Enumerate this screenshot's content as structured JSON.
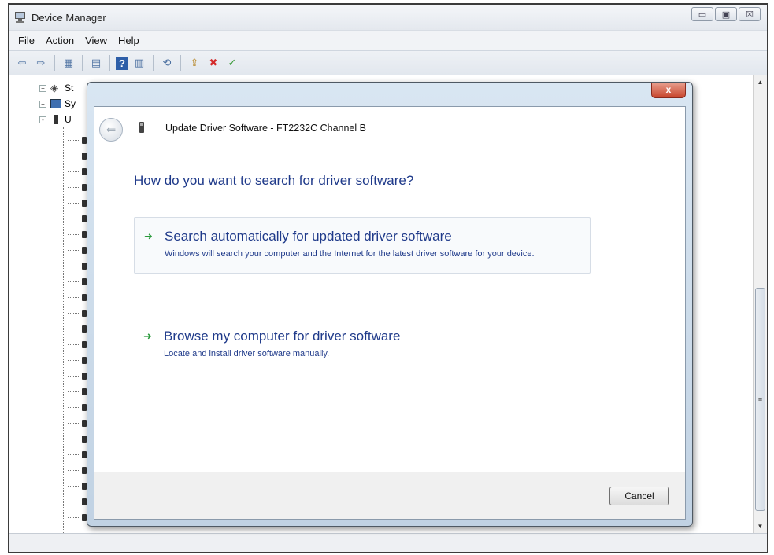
{
  "window": {
    "title": "Device Manager",
    "controls": {
      "minimize": "▭",
      "restore": "▣",
      "close": "☒"
    }
  },
  "menubar": {
    "items": [
      "File",
      "Action",
      "View",
      "Help"
    ]
  },
  "toolbar": {
    "buttons": [
      {
        "icon": "back-arrow-icon",
        "glyph": "⇦"
      },
      {
        "icon": "forward-arrow-icon",
        "glyph": "⇨"
      },
      {
        "icon": "show-hide-tree-icon",
        "glyph": "▦"
      },
      {
        "icon": "properties-icon",
        "glyph": "▤"
      },
      {
        "icon": "help-icon",
        "glyph": "?"
      },
      {
        "icon": "view-icon",
        "glyph": "▥"
      },
      {
        "icon": "scan-hardware-icon",
        "glyph": "⟲"
      },
      {
        "icon": "update-driver-icon",
        "glyph": "⇪"
      },
      {
        "icon": "uninstall-icon",
        "glyph": "✖"
      },
      {
        "icon": "enable-icon",
        "glyph": "✓"
      }
    ]
  },
  "tree": {
    "rows": [
      {
        "expander": "+",
        "label": "St"
      },
      {
        "expander": "+",
        "label": "Sy"
      },
      {
        "expander": "-",
        "label": "U"
      }
    ]
  },
  "dialog": {
    "close_label": "x",
    "title": "Update Driver Software - FT2232C Channel B",
    "question": "How do you want to search for driver software?",
    "options": [
      {
        "title": "Search automatically for updated driver software",
        "description": "Windows will search your computer and the Internet for the latest driver software for your device."
      },
      {
        "title": "Browse my computer for driver software",
        "description": "Locate and install driver software manually."
      }
    ],
    "cancel_label": "Cancel"
  },
  "colors": {
    "link_blue": "#1f3a8a",
    "arrow_green": "#2a9a3c",
    "close_red": "#c7452c"
  }
}
